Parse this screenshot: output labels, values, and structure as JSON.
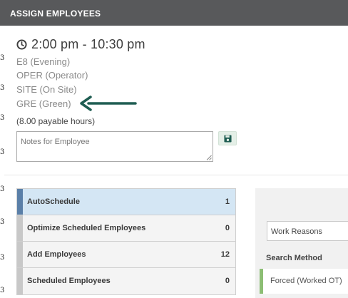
{
  "background": {
    "digits": [
      "3",
      "3",
      "3",
      "3",
      "3",
      "3",
      "3",
      "3"
    ]
  },
  "dialog": {
    "title": "ASSIGN EMPLOYEES",
    "shift_time": "2:00 pm - 10:30 pm",
    "details": [
      "E8 (Evening)",
      "OPER (Operator)",
      "SITE (On Site)",
      "GRE (Green)"
    ],
    "payable_hours": "(8.00 payable hours)",
    "notes": {
      "placeholder": "Notes for Employee",
      "value": ""
    },
    "save_icon": "floppy-disk-icon",
    "annotation_arrow_color": "#1f5d52"
  },
  "stats": [
    {
      "label": "AutoSchedule",
      "count": "1",
      "active": true
    },
    {
      "label": "Optimize Scheduled Employees",
      "count": "0",
      "active": false
    },
    {
      "label": "Add Employees",
      "count": "12",
      "active": false
    },
    {
      "label": "Scheduled Employees",
      "count": "0",
      "active": false
    }
  ],
  "right_panel": {
    "reason_select": "Work Reasons",
    "search_method_header": "Search Method",
    "search_method_option": "Forced (Worked OT)"
  },
  "colors": {
    "titlebar": "#58595b",
    "active_row": "#d4e6f4",
    "active_bar": "#5a7fa8",
    "forced_accent": "#8cbe74"
  }
}
